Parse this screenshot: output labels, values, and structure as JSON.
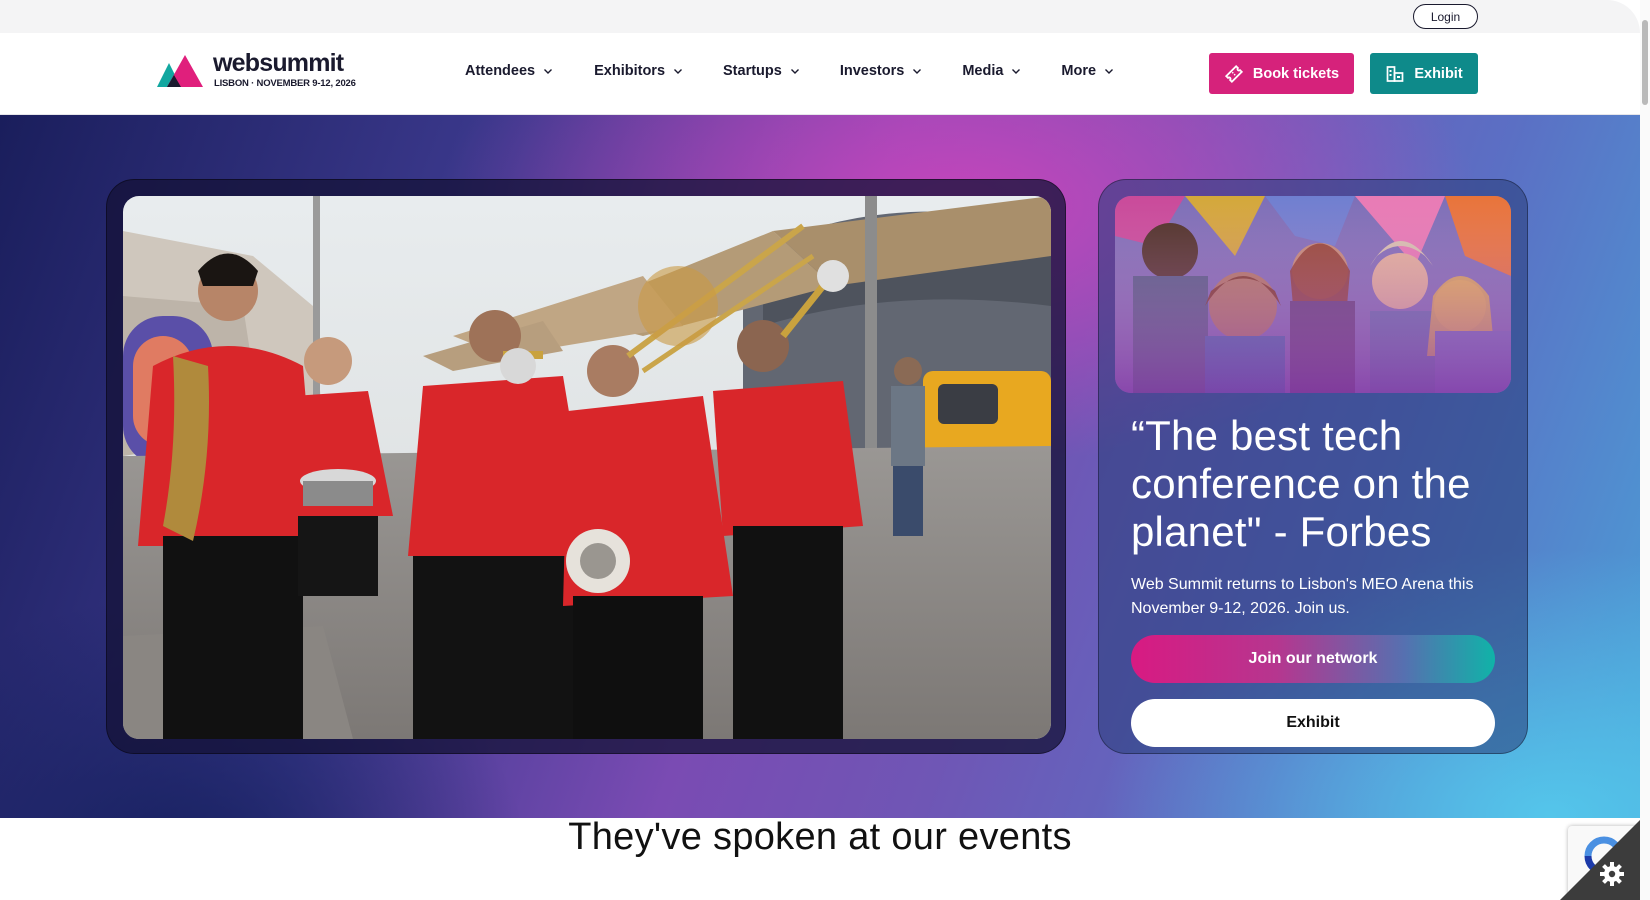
{
  "utility": {
    "login_label": "Login"
  },
  "logo": {
    "wordmark": "websummit",
    "subtitle": "LISBON · NOVEMBER 9-12, 2026"
  },
  "nav": {
    "items": [
      {
        "label": "Attendees"
      },
      {
        "label": "Exhibitors"
      },
      {
        "label": "Startups"
      },
      {
        "label": "Investors"
      },
      {
        "label": "Media"
      },
      {
        "label": "More"
      }
    ]
  },
  "header_actions": {
    "book_label": "Book tickets",
    "exhibit_label": "Exhibit"
  },
  "hero": {
    "quote": "“The best tech conference on the planet\" - Forbes",
    "description": "Web Summit returns to Lisbon's MEO Arena this November 9-12, 2026. Join us.",
    "join_label": "Join our network",
    "exhibit_label": "Exhibit"
  },
  "speakers_section": {
    "heading": "They've spoken at our events"
  },
  "colors": {
    "brand_pink": "#d6227b",
    "brand_teal": "#0e8a8a",
    "navy": "#1a1a2e"
  },
  "icons": {
    "ticket": "ticket-icon",
    "exhibit": "building-icon",
    "chevron": "chevron-down-icon",
    "cookie": "gear-icon",
    "recaptcha": "recaptcha-icon"
  }
}
